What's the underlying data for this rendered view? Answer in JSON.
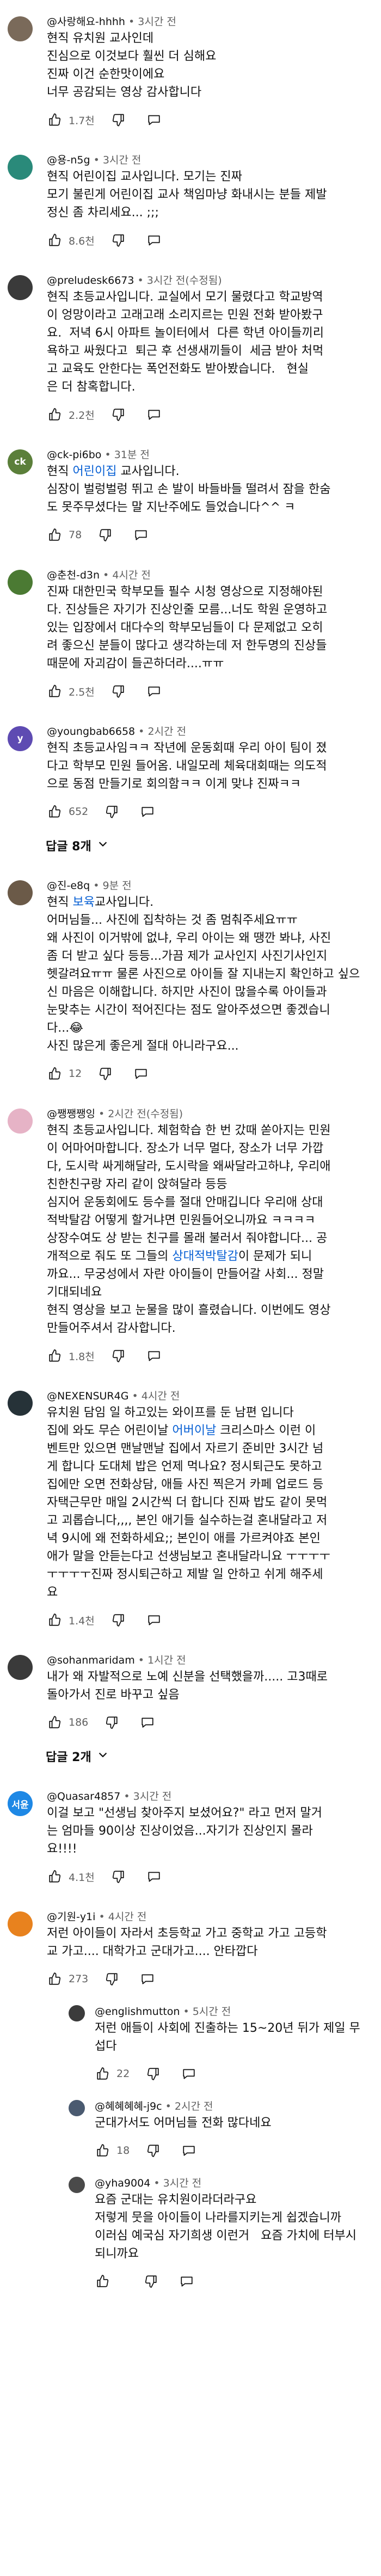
{
  "colors": {
    "link": "#065fd4",
    "meta": "#606060",
    "text": "#0f0f0f"
  },
  "icons": {
    "like": "thumbs-up-icon",
    "dislike": "thumbs-down-icon",
    "reply": "reply-icon",
    "expand": "chevron-down-icon"
  },
  "comments": [
    {
      "author": "@사랑해요-hhhh",
      "time": "3시간 전",
      "avatar_letter": "",
      "avatar_color": "#7a6a5a",
      "lines": [
        "현직 유치원 교사인데",
        "진심으로 이것보다 훨씬 더 심해요",
        "진짜 이건 순한맛이에요",
        "너무 공감되는 영상 감사합니다"
      ],
      "likes": "1.7천"
    },
    {
      "author": "@용-n5g",
      "time": "3시간 전",
      "avatar_letter": "",
      "avatar_color": "#2a8a7a",
      "lines": [
        "현직 어린이집 교사입니다. 모기는 진짜",
        "모기 불린게 어린이집 교사 책임마냥 화내시는 분들 제발",
        "정신 좀 차리세요... ;;;"
      ],
      "likes": "8.6천"
    },
    {
      "author": "@preludesk6673",
      "time": "3시간 전",
      "edited": "(수정됨)",
      "avatar_letter": "",
      "avatar_color": "#3a3a3a",
      "lines": [
        "현직 초등교사입니다. 교실에서 모기 물렸다고 학교방역",
        "이 엉망이라고 고래고래 소리지르는 민원 전화 받아봤구",
        "요.  저녁 6시 아파트 놀이터에서  다른 학년 아이들끼리",
        "욕하고 싸웠다고  퇴근 후 선생새끼들이  세금 받아 처먹",
        "고 교육도 안한다는 폭언전화도 받아봤습니다.   현실",
        "은 더 참혹합니다."
      ],
      "likes": "2.2천"
    },
    {
      "author": "@ck-pi6bo",
      "time": "31분 전",
      "avatar_letter": "ck",
      "avatar_color": "#5b7f3a",
      "lines": [
        "현직 {link:어린이집} 교사입니다.",
        "심장이 벌렁벌렁 뛰고 손 발이 바들바들 떨려서 잠을 한숨",
        "도 못주무셨다는 말 지난주에도 들었습니다^^ ㅋ"
      ],
      "likes": "78"
    },
    {
      "author": "@춘천-d3n",
      "time": "4시간 전",
      "avatar_letter": "",
      "avatar_color": "#4b7a33",
      "lines": [
        "진짜 대한민국 학부모들 필수 시청 영상으로 지정해야된",
        "다. 진상들은 자기가 진상인줄 모름...너도 학원 운영하고",
        "있는 입장에서 대다수의 학부모님들이 다 문제없고 오히",
        "려 좋으신 분들이 많다고 생각하는데 저 한두명의 진상들",
        "때문에 자괴감이 들곤하더라....ㅠㅠ"
      ],
      "likes": "2.5천"
    },
    {
      "author": "@youngbab6658",
      "time": "2시간 전",
      "avatar_letter": "y",
      "avatar_color": "#5e4bb2",
      "lines": [
        "현직 초등교사임ㅋㅋ 작년에 운동회때 우리 아이 팀이 졌",
        "다고 학부모 민원 들어옴. 내일모레 체육대회때는 의도적",
        "으로 동점 만들기로 회의함ㅋㅋ 이게 맞냐 진짜ㅋㅋ"
      ],
      "likes": "652",
      "replies": "답글 8개"
    },
    {
      "author": "@진-e8q",
      "time": "9분 전",
      "avatar_letter": "",
      "avatar_color": "#6b5a48",
      "lines": [
        "현직 {link:보육}교사입니다.",
        "어머님들... 사진에 집착하는 것 좀 멈춰주세요ㅠㅠ",
        "왜 사진이 이거밖에 없냐, 우리 아이는 왜 땡깐 봐냐, 사진",
        "좀 더 받고 싶다 등등...가끔 제가 교사인지 사진기사인지",
        "헷갈려요ㅠㅠ 물론 사진으로 아이들 잘 지내는지 확인하고 싶으",
        "신 마음은 이해합니다. 하지만 사진이 많을수록 아이들과",
        "눈맞추는 시간이 적어진다는 점도 알아주셨으면 좋겠습니",
        "다...😂",
        "사진 많은게 좋은게 절대 아니라구요..."
      ],
      "likes": "12"
    },
    {
      "author": "@쨍쨍쨍잉",
      "time": "2시간 전",
      "edited": "(수정됨)",
      "avatar_letter": "",
      "avatar_color": "#e6b3c6",
      "lines": [
        "현직 초등교사입니다. 체험학습 한 번 갔때 쏟아지는 민원",
        "이 어마어마합니다. 장소가 너무 멀다, 장소가 너무 가깝",
        "다, 도시락 싸게해달라, 도시락을 왜싸달라고하냐, 우리애",
        "친한친구랑 자리 같이 앉혀달라 등등",
        "심지어 운동회에도 등수를 절대 안매깁니다 우리애 상대",
        "적박탈감 어떻게 할거냐면 민원들어오니까요 ㅋㅋㅋㅋ",
        "상장수여도 상 받는 친구를 몰래 불러서 줘야합니다... 공",
        "개적으로 줘도 또 그들의 {link:상대적박탈감}이 문제가 되니",
        "까요... 무궁성에서 자란 아이들이 만들어갈 사회... 정말",
        "기대되네요",
        "현직 영상을 보고 눈물을 많이 흘렸습니다. 이번에도 영상",
        "만들어주셔서 감사합니다."
      ],
      "likes": "1.8천"
    },
    {
      "author": "@NEXENSUR4G",
      "time": "4시간 전",
      "avatar_letter": "",
      "avatar_color": "#263238",
      "lines": [
        "유치원 담임 일 하고있는 와이프를 둔 남편 입니다",
        "집에 와도 무슨 어린이날 {link:어버이날} 크리스마스 이런 이",
        "벤트만 있으면 맨날맨날 집에서 자르기 준비만 3시간 넘",
        "게 합니다 도대체 밥은 언제 먹나요? 정시퇴근도 못하고",
        "집에만 오면 전화상담, 애들 사진 찍은거 카페 업로드 등",
        "자택근무만 매일 2시간씩 더 합니다 진짜 밥도 같이 못먹",
        "고 괴롭습니다,,,, 본인 애기들 실수하는걸 혼내달라고 저",
        "녁 9시에 왜 전화하세요;; 본인이 애를 가르켜야죠 본인",
        "애가 말을 안듣는다고 선생님보고 혼내달라니요 ㅜㅜㅜㅜ",
        "ㅜㅜㅜㅜ진짜 정시퇴근하고 제발 일 안하고 쉬게 해주세",
        "요"
      ],
      "likes": "1.4천"
    },
    {
      "author": "@sohanmaridam",
      "time": "1시간 전",
      "avatar_letter": "",
      "avatar_color": "#3a3a3a",
      "lines": [
        "내가 왜 자발적으로 노예 신분을 선택했을까..... 고3때로",
        "돌아가서 진로 바꾸고 싶음"
      ],
      "likes": "186",
      "replies": "답글 2개"
    },
    {
      "author": "@Quasar4857",
      "time": "3시간 전",
      "avatar_letter": "서윤",
      "avatar_color": "#1e88e5",
      "lines": [
        "이걸 보고 \"선생님 찾아주지 보셨어요?\" 라고 먼저 말거",
        "는 엄마들 90이상 진상이었음...자기가 진상인지 몰라",
        "요!!!!"
      ],
      "likes": "4.1천"
    },
    {
      "author": "@기원-y1i",
      "time": "4시간 전",
      "avatar_letter": "",
      "avatar_color": "#e8821e",
      "lines": [
        "저런 아이들이 자라서 초등학교 가고 중학교 가고 고등학",
        "교 가고.... 대학가고 군대가고.... 안타깝다"
      ],
      "likes": "273",
      "reply_items": [
        {
          "author": "@englishmutton",
          "time": "5시간 전",
          "avatar_letter": "",
          "avatar_color": "#3b3b3b",
          "lines": [
            "저런 애들이 사회에 진출하는 15~20년 뒤가 제일 무",
            "섭다"
          ],
          "likes": "22"
        },
        {
          "author": "@혜혜혜혜-j9c",
          "time": "2시간 전",
          "avatar_letter": "",
          "avatar_color": "#4a5a70",
          "lines": [
            "군대가서도 어머님들 전화 많다네요"
          ],
          "likes": "18"
        },
        {
          "author": "@yha9004",
          "time": "3시간 전",
          "avatar_letter": "",
          "avatar_color": "#4a4a4a",
          "lines": [
            "요즘 군대는 유치원이라더라구요",
            "저렇게 뭇을 아이들이 나라를지키는게 쉽겠습니까",
            "이러심 예국심 자기희생 이런거   요즘 가치에 터부시",
            "되니까요"
          ],
          "likes": ""
        }
      ]
    }
  ]
}
